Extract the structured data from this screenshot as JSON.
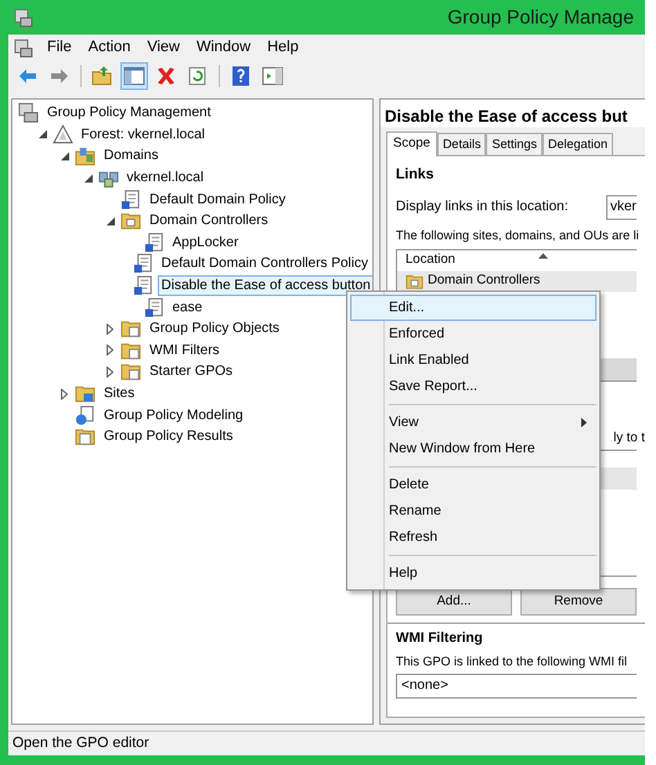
{
  "window": {
    "title": "Group Policy Manage"
  },
  "menu_bar": [
    "File",
    "Action",
    "View",
    "Window",
    "Help"
  ],
  "toolbar": [
    {
      "kind": "back",
      "pressed": false
    },
    {
      "kind": "forward",
      "pressed": false
    },
    {
      "kind": "up",
      "pressed": false
    },
    {
      "kind": "tree",
      "pressed": true
    },
    {
      "kind": "delete",
      "pressed": false
    },
    {
      "kind": "refresh",
      "pressed": false
    },
    {
      "kind": "help",
      "pressed": false
    },
    {
      "kind": "action-pane",
      "pressed": false
    }
  ],
  "tree": [
    {
      "label": "Group Policy Management",
      "kind": "console",
      "selected": false,
      "children": [
        {
          "label": "Forest: vkernel.local",
          "kind": "forest",
          "selected": false,
          "expanded": true,
          "children": [
            {
              "label": "Domains",
              "kind": "domains",
              "selected": false,
              "expanded": true,
              "children": [
                {
                  "label": "vkernel.local",
                  "kind": "domain",
                  "selected": false,
                  "expanded": true,
                  "children": [
                    {
                      "label": "Default Domain Policy",
                      "kind": "gpo",
                      "selected": false
                    },
                    {
                      "label": "Domain Controllers",
                      "kind": "ou",
                      "selected": false,
                      "expanded": true,
                      "children": [
                        {
                          "label": "AppLocker",
                          "kind": "gpo",
                          "selected": false
                        },
                        {
                          "label": "Default Domain Controllers Policy",
                          "kind": "gpo",
                          "selected": false
                        },
                        {
                          "label": "Disable the Ease of access button",
                          "kind": "gpo",
                          "selected": true
                        },
                        {
                          "label": "ease",
                          "kind": "gpo",
                          "selected": false
                        }
                      ]
                    },
                    {
                      "label": "Group Policy Objects",
                      "kind": "folder",
                      "selected": false,
                      "expanded": false
                    },
                    {
                      "label": "WMI Filters",
                      "kind": "folder",
                      "selected": false,
                      "expanded": false
                    },
                    {
                      "label": "Starter GPOs",
                      "kind": "folder",
                      "selected": false,
                      "expanded": false
                    }
                  ]
                }
              ]
            },
            {
              "label": "Sites",
              "kind": "sites",
              "selected": false,
              "expanded": false
            },
            {
              "label": "Group Policy Modeling",
              "kind": "modeling",
              "selected": false
            },
            {
              "label": "Group Policy Results",
              "kind": "results",
              "selected": false
            }
          ]
        }
      ]
    }
  ],
  "details": {
    "title": "Disable the Ease of access but",
    "tabs": [
      {
        "label": "Scope",
        "selected": true
      },
      {
        "label": "Details",
        "selected": false
      },
      {
        "label": "Settings",
        "selected": false
      },
      {
        "label": "Delegation",
        "selected": false
      }
    ],
    "links_heading": "Links",
    "display_label": "Display links in this location:",
    "display_value": "vker",
    "links_text": "The following sites, domains, and OUs are li",
    "links_columns": [
      "Location"
    ],
    "links_rows": [
      "Domain Controllers"
    ],
    "security_text_fragment": "ly to t",
    "buttons": [
      "Add...",
      "Remove"
    ],
    "wmi_heading": "WMI Filtering",
    "wmi_text": "This GPO is linked to the following WMI fil",
    "wmi_value": "<none>"
  },
  "context_menu": [
    [
      {
        "label": "Edit...",
        "selected": true,
        "submenu": false
      },
      {
        "label": "Enforced",
        "selected": false,
        "submenu": false
      },
      {
        "label": "Link Enabled",
        "selected": false,
        "submenu": false
      },
      {
        "label": "Save Report...",
        "selected": false,
        "submenu": false
      }
    ],
    [
      {
        "label": "View",
        "selected": false,
        "submenu": true
      },
      {
        "label": "New Window from Here",
        "selected": false,
        "submenu": false
      }
    ],
    [
      {
        "label": "Delete",
        "selected": false,
        "submenu": false
      },
      {
        "label": "Rename",
        "selected": false,
        "submenu": false
      },
      {
        "label": "Refresh",
        "selected": false,
        "submenu": false
      }
    ],
    [
      {
        "label": "Help",
        "selected": false,
        "submenu": false
      }
    ]
  ],
  "status_bar": "Open the GPO editor"
}
